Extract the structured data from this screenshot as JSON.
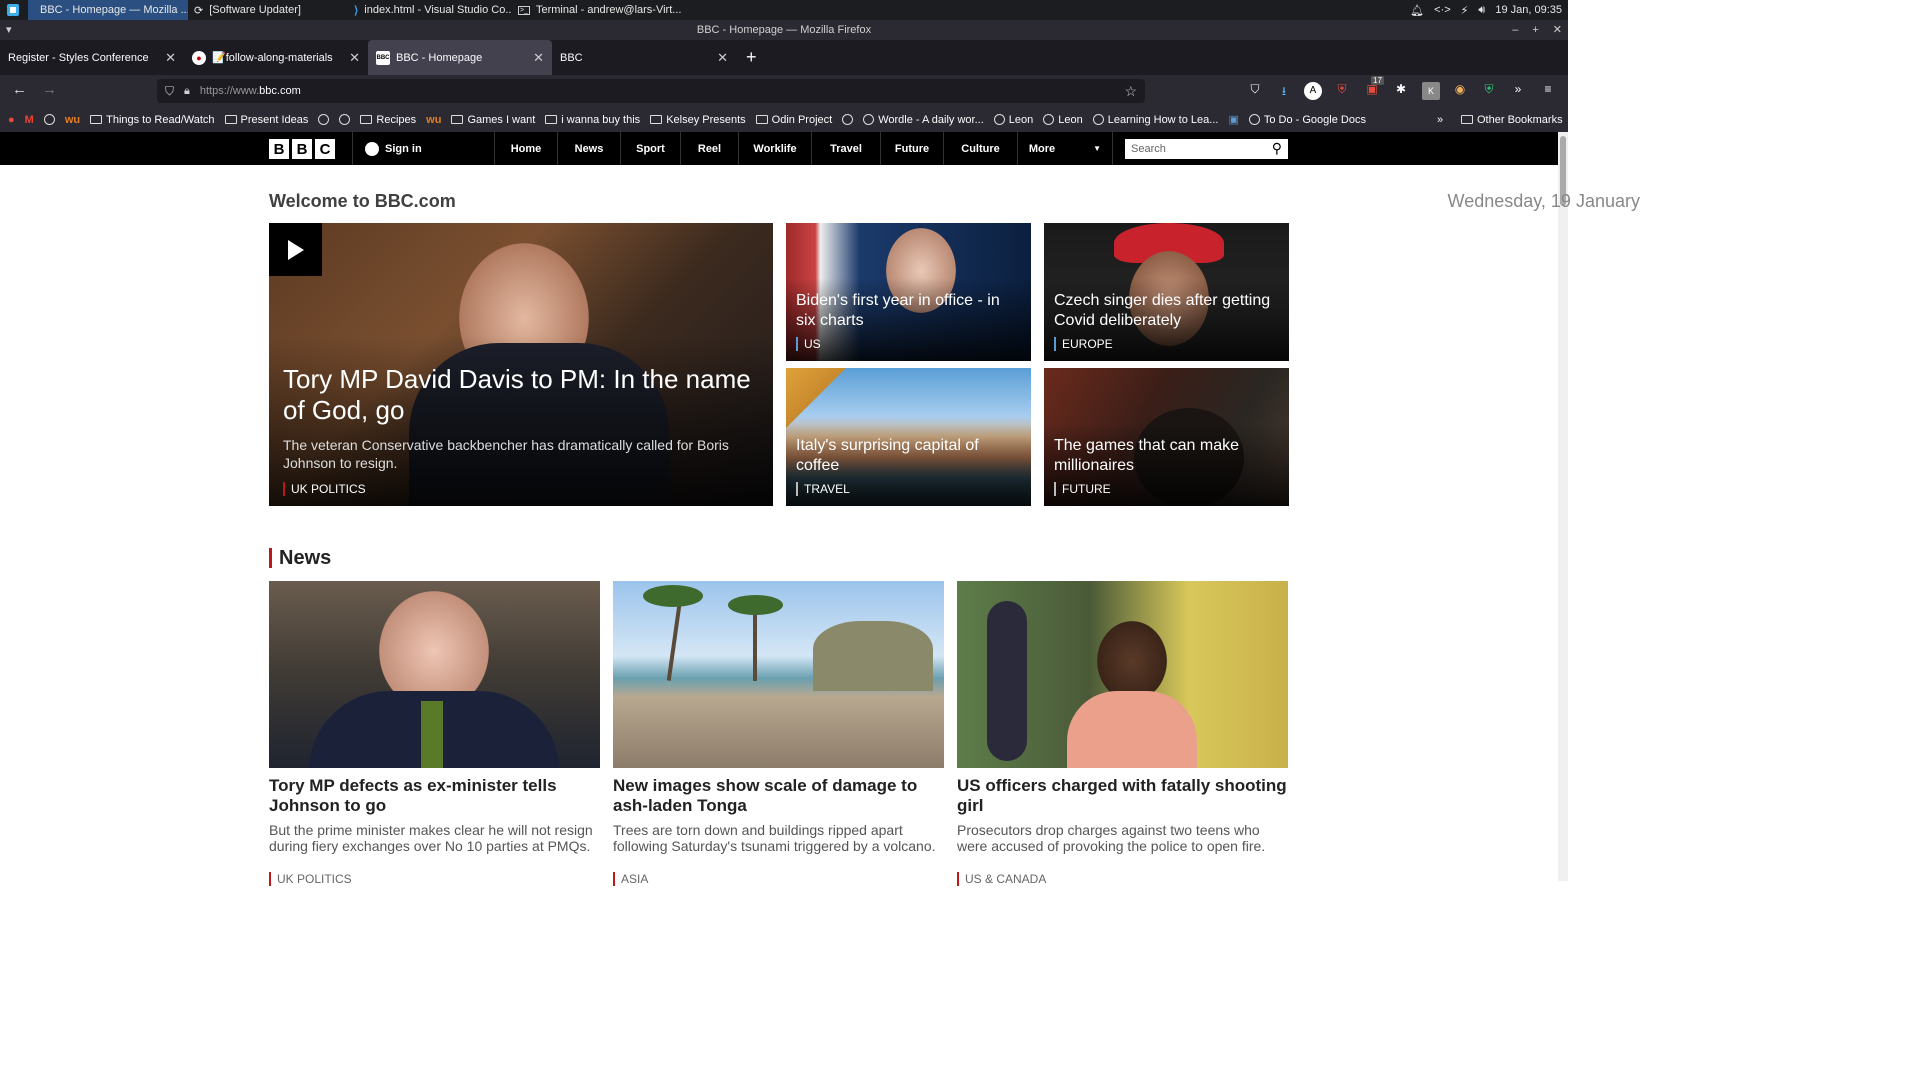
{
  "taskbar": {
    "tasks": [
      "BBC - Homepage — Mozilla ...",
      "[Software Updater]",
      "index.html - Visual Studio Co...",
      "Terminal - andrew@lars-Virt..."
    ],
    "clock": "19 Jan, 09:35"
  },
  "window": {
    "title": "BBC - Homepage — Mozilla Firefox"
  },
  "tabs": [
    {
      "title": "Register - Styles Conference"
    },
    {
      "title": "📝follow-along-materials"
    },
    {
      "title": "BBC - Homepage"
    },
    {
      "title": "BBC"
    }
  ],
  "url": {
    "protocol": "https://www.",
    "domain": "bbc.com",
    "badge_count": "17"
  },
  "bookmarks": [
    {
      "label": "Things to Read/Watch",
      "icon": "folder"
    },
    {
      "label": "Present Ideas",
      "icon": "folder"
    },
    {
      "label": "Recipes",
      "icon": "folder"
    },
    {
      "label": "Games I want",
      "icon": "folder"
    },
    {
      "label": "i wanna buy this",
      "icon": "folder"
    },
    {
      "label": "Kelsey Presents",
      "icon": "folder"
    },
    {
      "label": "Odin Project",
      "icon": "folder"
    },
    {
      "label": "Wordle - A daily wor...",
      "icon": "globe"
    },
    {
      "label": "Leon",
      "icon": "globe"
    },
    {
      "label": "Leon",
      "icon": "globe"
    },
    {
      "label": "Learning How to Lea...",
      "icon": "globe"
    },
    {
      "label": "To Do - Google Docs",
      "icon": "globe"
    }
  ],
  "other_bookmarks": "Other Bookmarks",
  "bbc": {
    "logo": [
      "B",
      "B",
      "C"
    ],
    "signin": "Sign in",
    "nav": [
      "Home",
      "News",
      "Sport",
      "Reel",
      "Worklife",
      "Travel",
      "Future",
      "Culture",
      "More"
    ],
    "search_placeholder": "Search"
  },
  "welcome": "Welcome to BBC.com",
  "date": "Wednesday, 19 January",
  "lead": {
    "headline": "Tory MP David Davis to PM: In the name of God, go",
    "summary": "The veteran Conservative backbencher has dramatically called for Boris Johnson to resign.",
    "category": "UK POLITICS"
  },
  "promos": [
    {
      "headline": "Biden's first year in office - in six charts",
      "category": "US",
      "accent": "#5a9bd4"
    },
    {
      "headline": "Czech singer dies after getting Covid deliberately",
      "category": "EUROPE",
      "accent": "#5a9bd4"
    },
    {
      "headline": "Italy's surprising capital of coffee",
      "category": "TRAVEL",
      "accent": "#bbbbbb"
    },
    {
      "headline": "The games that can make millionaires",
      "category": "FUTURE",
      "accent": "#bbbbbb"
    }
  ],
  "news": {
    "title": "News",
    "cards": [
      {
        "headline": "Tory MP defects as ex-minister tells Johnson to go",
        "summary": "But the prime minister makes clear he will not resign during fiery exchanges over No 10 parties at PMQs.",
        "category": "UK POLITICS"
      },
      {
        "headline": "New images show scale of damage to ash-laden Tonga",
        "summary": "Trees are torn down and buildings ripped apart following Saturday's tsunami triggered by a volcano.",
        "category": "ASIA"
      },
      {
        "headline": "US officers charged with fatally shooting girl",
        "summary": "Prosecutors drop charges against two teens who were accused of provoking the police to open fire.",
        "category": "US & CANADA"
      }
    ]
  },
  "colors": {
    "bbc_red": "#bb1919",
    "firefox_tab": "#42414d",
    "taskbar_active": "#2a4f80"
  }
}
